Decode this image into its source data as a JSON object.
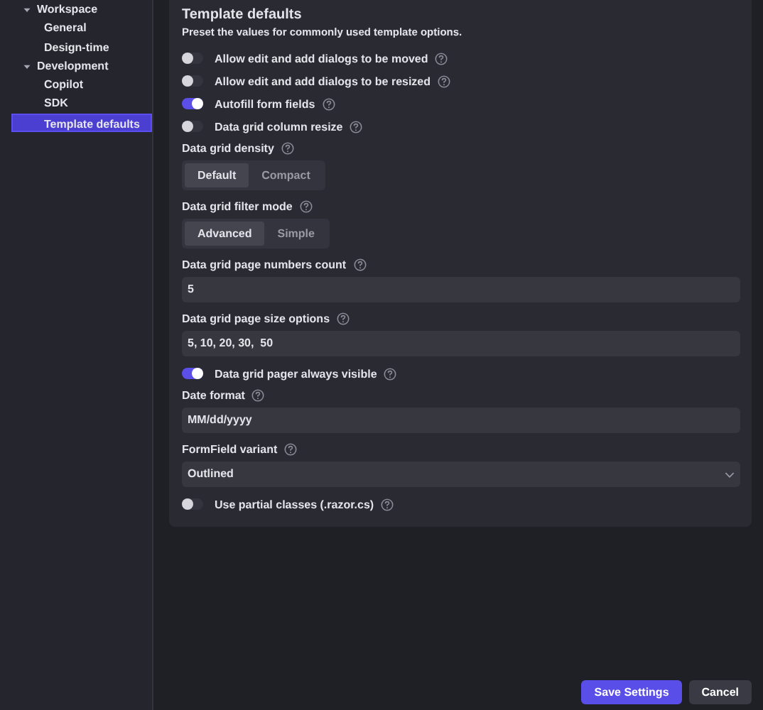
{
  "sidebar": {
    "items": [
      {
        "label": "Workspace",
        "expanded": true,
        "selected": false,
        "children": [
          {
            "label": "General",
            "selected": false
          },
          {
            "label": "Design-time",
            "selected": false
          }
        ]
      },
      {
        "label": "Development",
        "expanded": true,
        "selected": false,
        "children": [
          {
            "label": "Copilot",
            "selected": false
          },
          {
            "label": "SDK",
            "selected": false
          },
          {
            "label": "Template defaults",
            "selected": true
          }
        ]
      }
    ]
  },
  "section": {
    "title": "Template defaults",
    "description": "Preset the values for commonly used template options.",
    "settings": [
      {
        "kind": "toggle",
        "label": "Allow edit and add dialogs to be moved",
        "on": false
      },
      {
        "kind": "toggle",
        "label": "Allow edit and add dialogs to be resized",
        "on": false
      },
      {
        "kind": "toggle",
        "label": "Autofill form fields",
        "on": true
      },
      {
        "kind": "toggle",
        "label": "Data grid column resize",
        "on": false
      },
      {
        "kind": "segmented",
        "label": "Data grid density",
        "options": [
          {
            "label": "Default",
            "selected": true
          },
          {
            "label": "Compact",
            "selected": false
          }
        ]
      },
      {
        "kind": "segmented",
        "label": "Data grid filter mode",
        "options": [
          {
            "label": "Advanced",
            "selected": true
          },
          {
            "label": "Simple",
            "selected": false
          }
        ]
      },
      {
        "kind": "input",
        "label": "Data grid page numbers count",
        "value": "5"
      },
      {
        "kind": "input",
        "label": "Data grid page size options",
        "value": "5, 10, 20, 30,  50"
      },
      {
        "kind": "toggle",
        "label": "Data grid pager always visible",
        "on": true
      },
      {
        "kind": "input",
        "label": "Date format",
        "value": "MM/dd/yyyy"
      },
      {
        "kind": "select",
        "label": "FormField variant",
        "value": "Outlined"
      },
      {
        "kind": "toggle",
        "label": "Use partial classes (.razor.cs)",
        "on": false
      }
    ]
  },
  "buttons": [
    {
      "label": "Save Settings",
      "kind": "primary"
    },
    {
      "label": "Cancel",
      "kind": "secondary"
    }
  ]
}
